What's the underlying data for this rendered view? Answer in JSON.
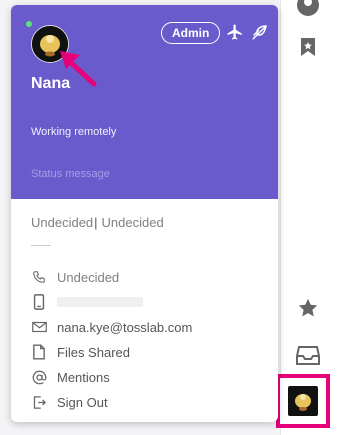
{
  "profile": {
    "name": "Nana",
    "role_badge": "Admin",
    "status_text": "Working remotely",
    "status_message_placeholder": "Status message",
    "online_color": "#5ee07a"
  },
  "header_icons": [
    "airplane-icon",
    "dnd-leaf-icon"
  ],
  "summary": {
    "field_a": "Undecided",
    "separator": "|",
    "field_b": "Undecided"
  },
  "details": [
    {
      "icon": "phone-icon",
      "label": "Undecided"
    },
    {
      "icon": "mobile-icon",
      "label": ""
    },
    {
      "icon": "mail-icon",
      "label": "nana.kye@tosslab.com"
    },
    {
      "icon": "file-icon",
      "label": "Files Shared"
    },
    {
      "icon": "at-icon",
      "label": "Mentions"
    },
    {
      "icon": "signout-icon",
      "label": "Sign Out"
    }
  ],
  "right_rail": [
    "profile-icon",
    "bookmark-icon",
    "star-icon",
    "inbox-icon",
    "user-avatar"
  ],
  "colors": {
    "header_bg": "#6a5bcd",
    "highlight": "#e6007a"
  }
}
